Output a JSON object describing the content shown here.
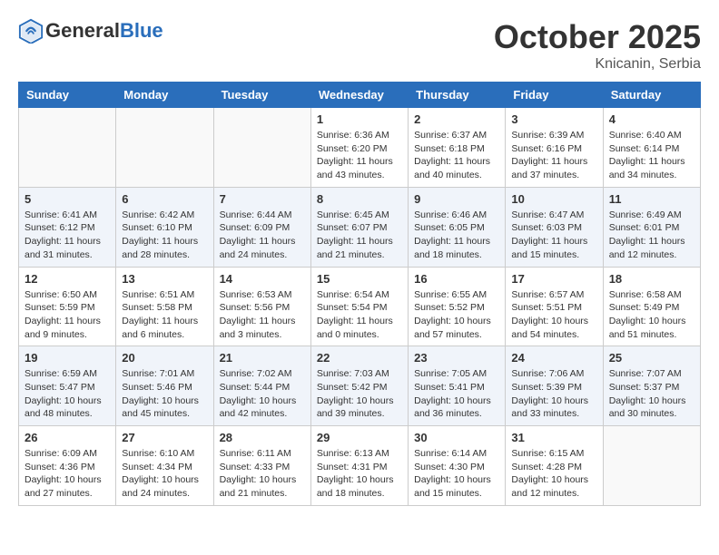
{
  "header": {
    "logo_general": "General",
    "logo_blue": "Blue",
    "month_year": "October 2025",
    "location": "Knicanin, Serbia"
  },
  "days_of_week": [
    "Sunday",
    "Monday",
    "Tuesday",
    "Wednesday",
    "Thursday",
    "Friday",
    "Saturday"
  ],
  "weeks": [
    [
      {
        "day": "",
        "info": ""
      },
      {
        "day": "",
        "info": ""
      },
      {
        "day": "",
        "info": ""
      },
      {
        "day": "1",
        "info": "Sunrise: 6:36 AM\nSunset: 6:20 PM\nDaylight: 11 hours\nand 43 minutes."
      },
      {
        "day": "2",
        "info": "Sunrise: 6:37 AM\nSunset: 6:18 PM\nDaylight: 11 hours\nand 40 minutes."
      },
      {
        "day": "3",
        "info": "Sunrise: 6:39 AM\nSunset: 6:16 PM\nDaylight: 11 hours\nand 37 minutes."
      },
      {
        "day": "4",
        "info": "Sunrise: 6:40 AM\nSunset: 6:14 PM\nDaylight: 11 hours\nand 34 minutes."
      }
    ],
    [
      {
        "day": "5",
        "info": "Sunrise: 6:41 AM\nSunset: 6:12 PM\nDaylight: 11 hours\nand 31 minutes."
      },
      {
        "day": "6",
        "info": "Sunrise: 6:42 AM\nSunset: 6:10 PM\nDaylight: 11 hours\nand 28 minutes."
      },
      {
        "day": "7",
        "info": "Sunrise: 6:44 AM\nSunset: 6:09 PM\nDaylight: 11 hours\nand 24 minutes."
      },
      {
        "day": "8",
        "info": "Sunrise: 6:45 AM\nSunset: 6:07 PM\nDaylight: 11 hours\nand 21 minutes."
      },
      {
        "day": "9",
        "info": "Sunrise: 6:46 AM\nSunset: 6:05 PM\nDaylight: 11 hours\nand 18 minutes."
      },
      {
        "day": "10",
        "info": "Sunrise: 6:47 AM\nSunset: 6:03 PM\nDaylight: 11 hours\nand 15 minutes."
      },
      {
        "day": "11",
        "info": "Sunrise: 6:49 AM\nSunset: 6:01 PM\nDaylight: 11 hours\nand 12 minutes."
      }
    ],
    [
      {
        "day": "12",
        "info": "Sunrise: 6:50 AM\nSunset: 5:59 PM\nDaylight: 11 hours\nand 9 minutes."
      },
      {
        "day": "13",
        "info": "Sunrise: 6:51 AM\nSunset: 5:58 PM\nDaylight: 11 hours\nand 6 minutes."
      },
      {
        "day": "14",
        "info": "Sunrise: 6:53 AM\nSunset: 5:56 PM\nDaylight: 11 hours\nand 3 minutes."
      },
      {
        "day": "15",
        "info": "Sunrise: 6:54 AM\nSunset: 5:54 PM\nDaylight: 11 hours\nand 0 minutes."
      },
      {
        "day": "16",
        "info": "Sunrise: 6:55 AM\nSunset: 5:52 PM\nDaylight: 10 hours\nand 57 minutes."
      },
      {
        "day": "17",
        "info": "Sunrise: 6:57 AM\nSunset: 5:51 PM\nDaylight: 10 hours\nand 54 minutes."
      },
      {
        "day": "18",
        "info": "Sunrise: 6:58 AM\nSunset: 5:49 PM\nDaylight: 10 hours\nand 51 minutes."
      }
    ],
    [
      {
        "day": "19",
        "info": "Sunrise: 6:59 AM\nSunset: 5:47 PM\nDaylight: 10 hours\nand 48 minutes."
      },
      {
        "day": "20",
        "info": "Sunrise: 7:01 AM\nSunset: 5:46 PM\nDaylight: 10 hours\nand 45 minutes."
      },
      {
        "day": "21",
        "info": "Sunrise: 7:02 AM\nSunset: 5:44 PM\nDaylight: 10 hours\nand 42 minutes."
      },
      {
        "day": "22",
        "info": "Sunrise: 7:03 AM\nSunset: 5:42 PM\nDaylight: 10 hours\nand 39 minutes."
      },
      {
        "day": "23",
        "info": "Sunrise: 7:05 AM\nSunset: 5:41 PM\nDaylight: 10 hours\nand 36 minutes."
      },
      {
        "day": "24",
        "info": "Sunrise: 7:06 AM\nSunset: 5:39 PM\nDaylight: 10 hours\nand 33 minutes."
      },
      {
        "day": "25",
        "info": "Sunrise: 7:07 AM\nSunset: 5:37 PM\nDaylight: 10 hours\nand 30 minutes."
      }
    ],
    [
      {
        "day": "26",
        "info": "Sunrise: 6:09 AM\nSunset: 4:36 PM\nDaylight: 10 hours\nand 27 minutes."
      },
      {
        "day": "27",
        "info": "Sunrise: 6:10 AM\nSunset: 4:34 PM\nDaylight: 10 hours\nand 24 minutes."
      },
      {
        "day": "28",
        "info": "Sunrise: 6:11 AM\nSunset: 4:33 PM\nDaylight: 10 hours\nand 21 minutes."
      },
      {
        "day": "29",
        "info": "Sunrise: 6:13 AM\nSunset: 4:31 PM\nDaylight: 10 hours\nand 18 minutes."
      },
      {
        "day": "30",
        "info": "Sunrise: 6:14 AM\nSunset: 4:30 PM\nDaylight: 10 hours\nand 15 minutes."
      },
      {
        "day": "31",
        "info": "Sunrise: 6:15 AM\nSunset: 4:28 PM\nDaylight: 10 hours\nand 12 minutes."
      },
      {
        "day": "",
        "info": ""
      }
    ]
  ]
}
